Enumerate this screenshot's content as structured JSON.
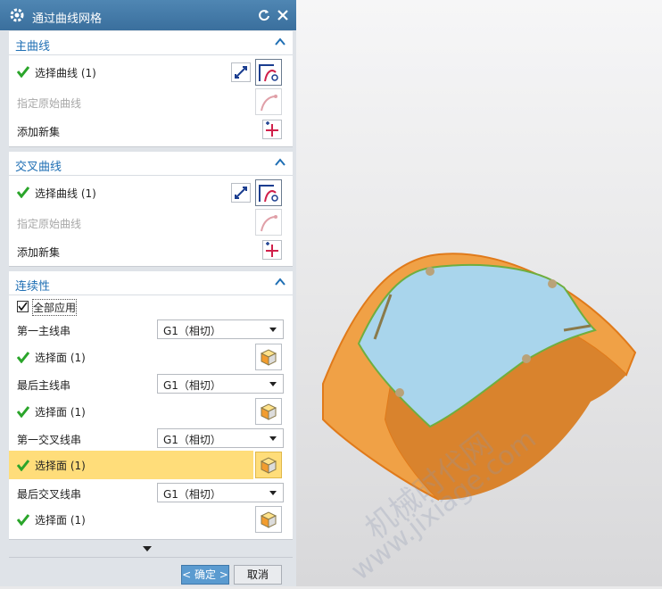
{
  "dialog": {
    "title": "通过曲线网格",
    "ok_label": "< 确定 >",
    "cancel_label": "取消"
  },
  "primary": {
    "title": "主曲线",
    "select_curve": "选择曲线 (1)",
    "specify_original": "指定原始曲线",
    "add_new_set": "添加新集"
  },
  "cross": {
    "title": "交叉曲线",
    "select_curve": "选择曲线 (1)",
    "specify_original": "指定原始曲线",
    "add_new_set": "添加新集"
  },
  "continuity": {
    "title": "连续性",
    "apply_all": "全部应用",
    "apply_all_checked": true,
    "rows": [
      {
        "label": "第一主线串",
        "value": "G1（相切）",
        "face": "选择面 (1)"
      },
      {
        "label": "最后主线串",
        "value": "G1（相切）",
        "face": "选择面 (1)"
      },
      {
        "label": "第一交叉线串",
        "value": "G1（相切）",
        "face": "选择面 (1)"
      },
      {
        "label": "最后交叉线串",
        "value": "G1（相切）",
        "face": "选择面 (1)"
      }
    ]
  },
  "watermark": {
    "line1": "机械时代网",
    "line2": "www.jixiage.com"
  },
  "colors": {
    "accent": "#1f6fb4",
    "check": "#2aa52a",
    "highlight": "#ffdd7a",
    "surface_orange": "#f0a146",
    "surface_blue": "#a9d5ec"
  }
}
